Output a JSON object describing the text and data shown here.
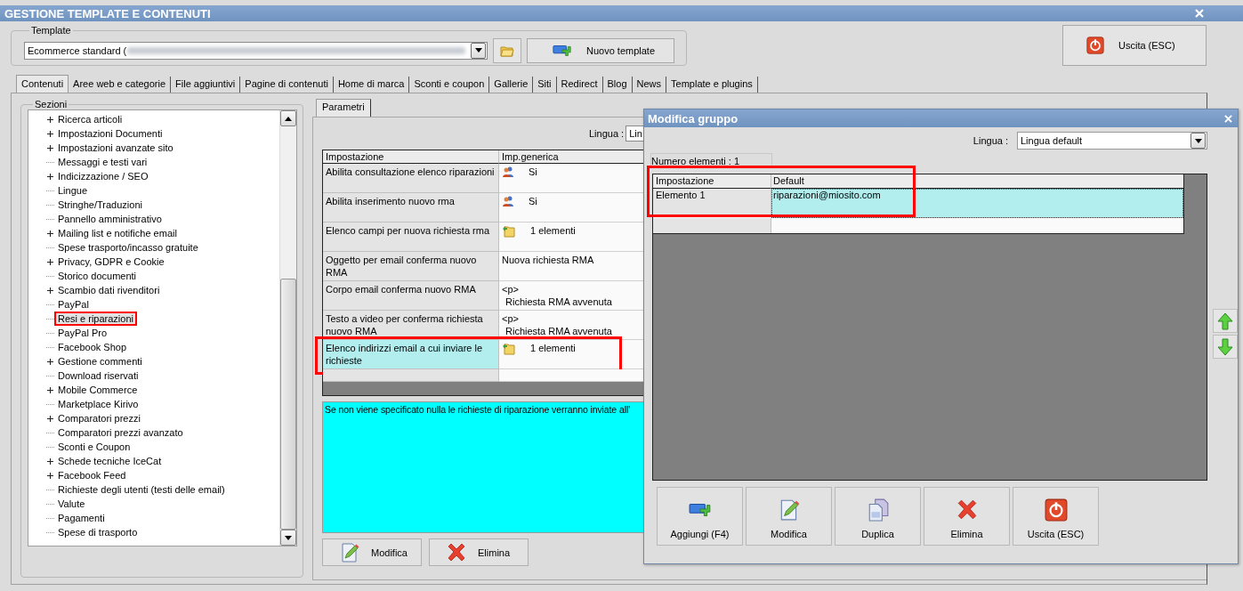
{
  "window": {
    "title": "GESTIONE TEMPLATE E CONTENUTI"
  },
  "template": {
    "label": "Template",
    "value": "Ecommerce standard (",
    "new_button": "Nuovo template"
  },
  "exit_button": "Uscita (ESC)",
  "tabs": [
    {
      "label": "Contenuti",
      "selected": true
    },
    {
      "label": "Aree web e categorie",
      "selected": false
    },
    {
      "label": "File aggiuntivi",
      "selected": false
    },
    {
      "label": "Pagine di contenuti",
      "selected": false
    },
    {
      "label": "Home di marca",
      "selected": false
    },
    {
      "label": "Sconti e coupon",
      "selected": false
    },
    {
      "label": "Gallerie",
      "selected": false
    },
    {
      "label": "Siti",
      "selected": false
    },
    {
      "label": "Redirect",
      "selected": false
    },
    {
      "label": "Blog",
      "selected": false
    },
    {
      "label": "News",
      "selected": false
    },
    {
      "label": "Template e plugins",
      "selected": false
    }
  ],
  "sections": {
    "label": "Sezioni",
    "items": [
      {
        "label": "Ricerca articoli",
        "expandable": true,
        "selected": false,
        "highlighted": false
      },
      {
        "label": "Impostazioni Documenti",
        "expandable": true,
        "selected": false,
        "highlighted": false
      },
      {
        "label": "Impostazioni avanzate sito",
        "expandable": true,
        "selected": false,
        "highlighted": false
      },
      {
        "label": "Messaggi e testi vari",
        "expandable": false,
        "selected": false,
        "highlighted": false
      },
      {
        "label": "Indicizzazione / SEO",
        "expandable": true,
        "selected": false,
        "highlighted": false
      },
      {
        "label": "Lingue",
        "expandable": false,
        "selected": false,
        "highlighted": false
      },
      {
        "label": "Stringhe/Traduzioni",
        "expandable": false,
        "selected": false,
        "highlighted": false
      },
      {
        "label": "Pannello amministrativo",
        "expandable": false,
        "selected": false,
        "highlighted": false
      },
      {
        "label": "Mailing list e notifiche email",
        "expandable": true,
        "selected": false,
        "highlighted": false
      },
      {
        "label": "Spese trasporto/incasso gratuite",
        "expandable": false,
        "selected": false,
        "highlighted": false
      },
      {
        "label": "Privacy, GDPR e Cookie",
        "expandable": true,
        "selected": false,
        "highlighted": false
      },
      {
        "label": "Storico documenti",
        "expandable": false,
        "selected": false,
        "highlighted": false
      },
      {
        "label": "Scambio dati rivenditori",
        "expandable": true,
        "selected": false,
        "highlighted": false
      },
      {
        "label": "PayPal",
        "expandable": false,
        "selected": false,
        "highlighted": false
      },
      {
        "label": "Resi e riparazioni",
        "expandable": false,
        "selected": true,
        "highlighted": true
      },
      {
        "label": "PayPal Pro",
        "expandable": false,
        "selected": false,
        "highlighted": false
      },
      {
        "label": "Facebook Shop",
        "expandable": false,
        "selected": false,
        "highlighted": false
      },
      {
        "label": "Gestione commenti",
        "expandable": true,
        "selected": false,
        "highlighted": false
      },
      {
        "label": "Download riservati",
        "expandable": false,
        "selected": false,
        "highlighted": false
      },
      {
        "label": "Mobile Commerce",
        "expandable": true,
        "selected": false,
        "highlighted": false
      },
      {
        "label": "Marketplace Kirivo",
        "expandable": false,
        "selected": false,
        "highlighted": false
      },
      {
        "label": "Comparatori prezzi",
        "expandable": true,
        "selected": false,
        "highlighted": false
      },
      {
        "label": "Comparatori prezzi avanzato",
        "expandable": false,
        "selected": false,
        "highlighted": false
      },
      {
        "label": "Sconti e Coupon",
        "expandable": false,
        "selected": false,
        "highlighted": false
      },
      {
        "label": "Schede tecniche IceCat",
        "expandable": true,
        "selected": false,
        "highlighted": false
      },
      {
        "label": "Facebook Feed",
        "expandable": true,
        "selected": false,
        "highlighted": false
      },
      {
        "label": "Richieste degli utenti (testi delle email)",
        "expandable": false,
        "selected": false,
        "highlighted": false
      },
      {
        "label": "Valute",
        "expandable": false,
        "selected": false,
        "highlighted": false
      },
      {
        "label": "Pagamenti",
        "expandable": false,
        "selected": false,
        "highlighted": false
      },
      {
        "label": "Spese di trasporto",
        "expandable": false,
        "selected": false,
        "highlighted": false
      }
    ]
  },
  "params": {
    "tab": "Parametri",
    "language_label": "Lingua :",
    "language_value": "Lin",
    "columns": [
      "Impostazione",
      "Imp.generica"
    ],
    "rows": [
      {
        "setting": "Abilita consultazione elenco riparazioni",
        "kind": "people",
        "lines": [
          "Si"
        ],
        "selected": false,
        "highlighted": false
      },
      {
        "setting": "Abilita inserimento nuovo rma",
        "kind": "people",
        "lines": [
          "Si"
        ],
        "selected": false,
        "highlighted": false
      },
      {
        "setting": "Elenco campi per nuova richiesta rma",
        "kind": "folder",
        "lines": [
          "1 elementi"
        ],
        "selected": false,
        "highlighted": false
      },
      {
        "setting": "Oggetto per email conferma nuovo RMA",
        "kind": "text",
        "lines": [
          "Nuova richiesta RMA"
        ],
        "selected": false,
        "highlighted": false
      },
      {
        "setting": "Corpo email conferma nuovo RMA",
        "kind": "text",
        "lines": [
          "<p>",
          "Richiesta RMA avvenuta"
        ],
        "selected": false,
        "highlighted": false
      },
      {
        "setting": "Testo a video per conferma richiesta nuovo RMA",
        "kind": "text",
        "lines": [
          "<p>",
          "Richiesta RMA avvenuta"
        ],
        "selected": false,
        "highlighted": false
      },
      {
        "setting": "Elenco indirizzi email a cui inviare le richieste",
        "kind": "folder",
        "lines": [
          "1 elementi"
        ],
        "selected": true,
        "highlighted": true
      }
    ],
    "help_text": "Se non viene specificato nulla le richieste di riparazione verranno inviate all'",
    "buttons": [
      {
        "label": "Modifica",
        "kind": "edit"
      },
      {
        "label": "Elimina",
        "kind": "delete"
      }
    ]
  },
  "dialog": {
    "title": "Modifica gruppo",
    "language_label": "Lingua :",
    "language_value": "Lingua default",
    "count": "Numero elementi : 1",
    "columns": [
      "Impostazione",
      "Default"
    ],
    "rows": [
      {
        "setting": "Elemento 1",
        "value": "riparazioni@miosito.com",
        "selected": true
      }
    ],
    "highlighted": true,
    "buttons": [
      {
        "label": "Aggiungi (F4)",
        "kind": "add"
      },
      {
        "label": "Modifica",
        "kind": "edit"
      },
      {
        "label": "Duplica",
        "kind": "duplicate"
      },
      {
        "label": "Elimina",
        "kind": "delete"
      },
      {
        "label": "Uscita (ESC)",
        "kind": "exit"
      }
    ]
  }
}
